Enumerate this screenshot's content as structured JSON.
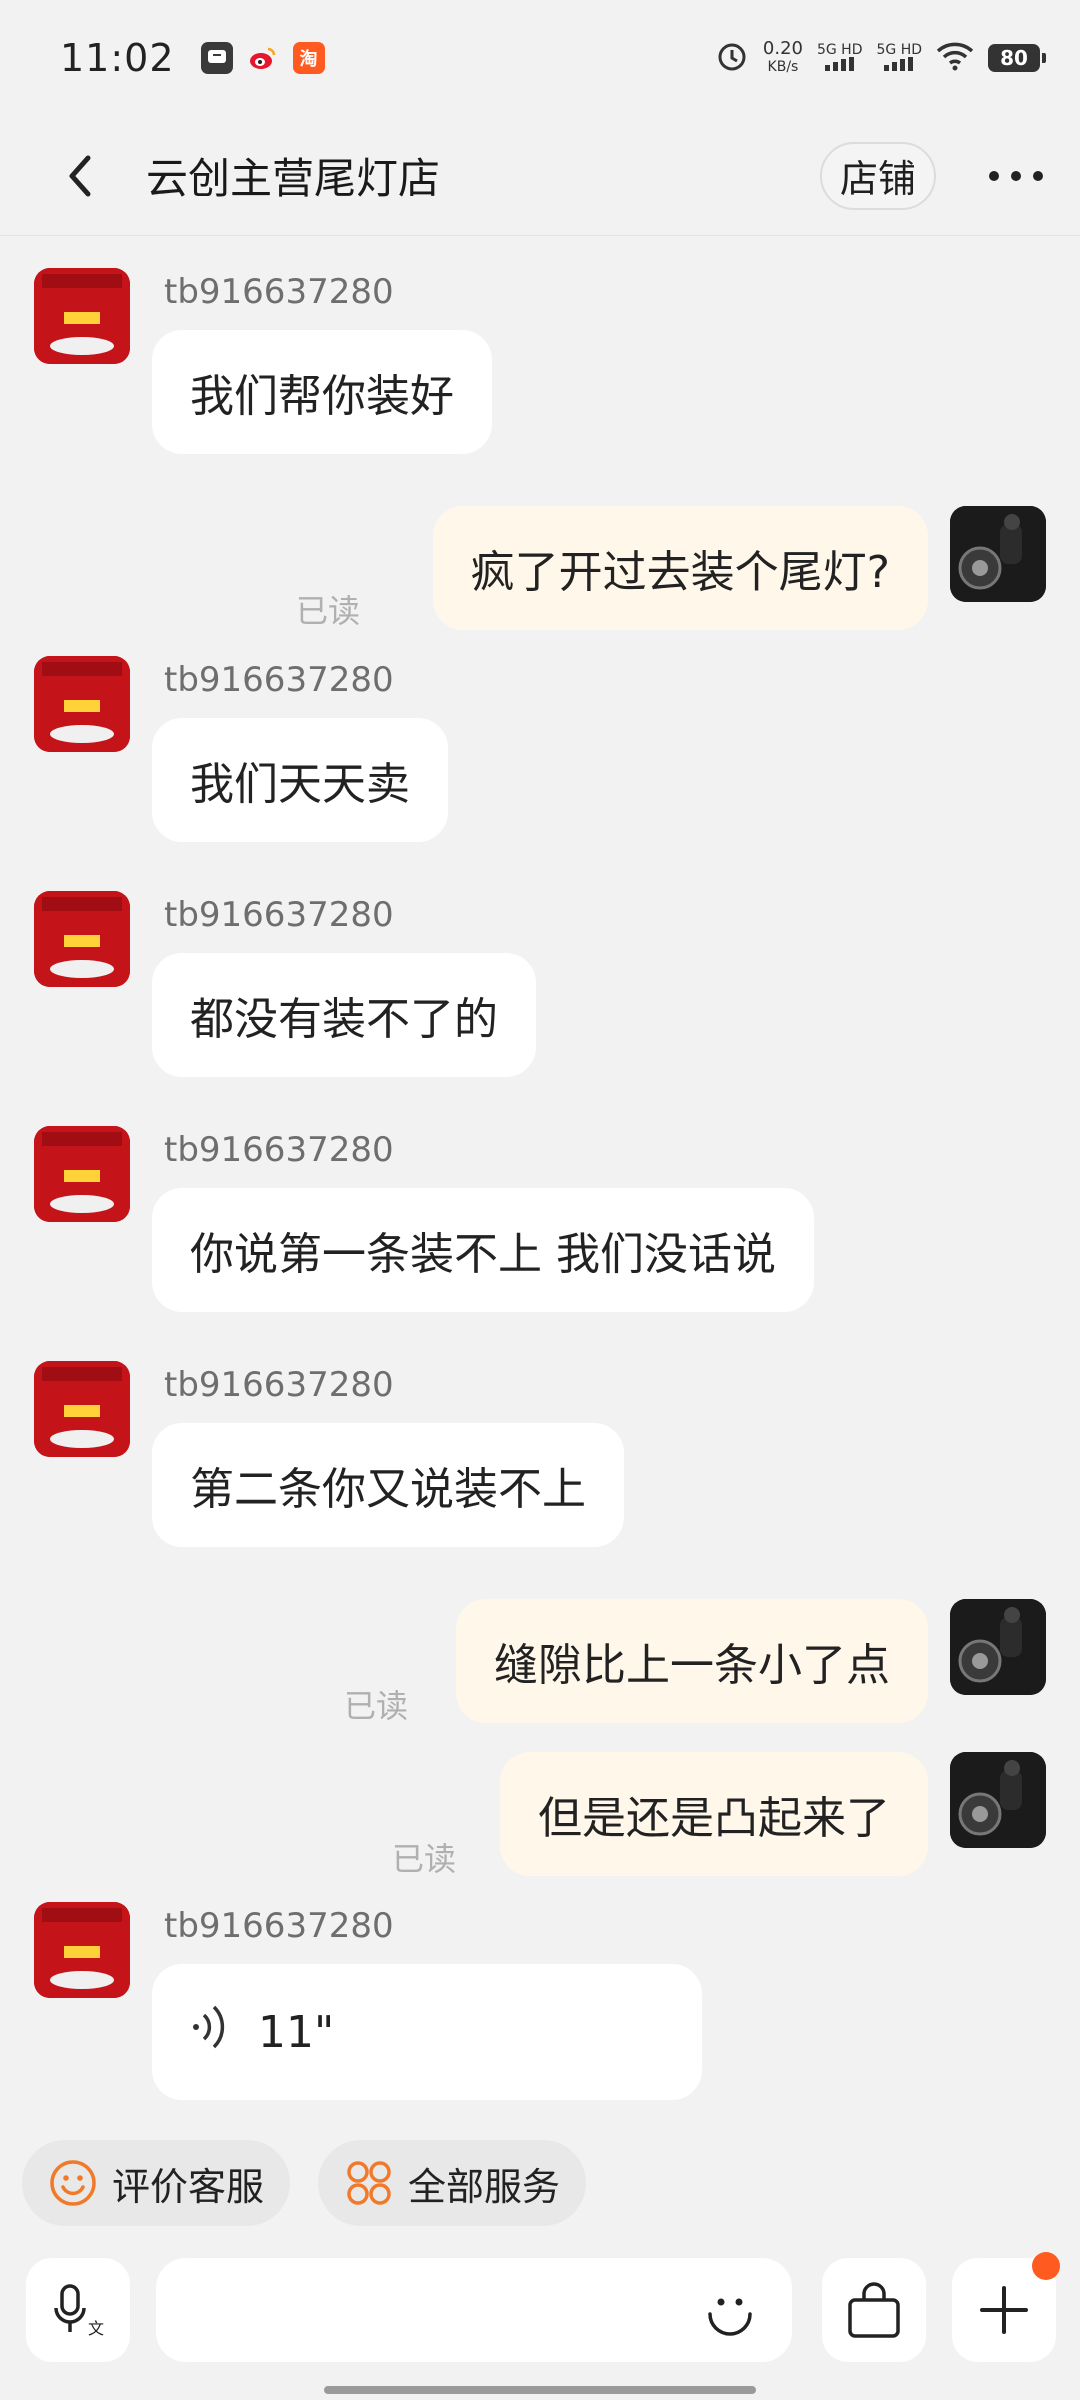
{
  "status_bar": {
    "time": "11:02",
    "net_speed": "0.20",
    "net_unit": "KB/s",
    "sim1": "5G HD",
    "sim2": "5G HD",
    "battery": "80",
    "apps": [
      "message-icon",
      "weibo-icon",
      "taobao-icon"
    ],
    "taobao_label": "淘"
  },
  "header": {
    "title": "云创主营尾灯店",
    "store_button": "店铺"
  },
  "messages": [
    {
      "from": "shop",
      "sender": "tb916637280",
      "text": "我们帮你装好"
    },
    {
      "from": "me",
      "text": "疯了开过去装个尾灯?",
      "status": "已读"
    },
    {
      "from": "shop",
      "sender": "tb916637280",
      "text": "我们天天卖"
    },
    {
      "from": "shop",
      "sender": "tb916637280",
      "text": "都没有装不了的"
    },
    {
      "from": "shop",
      "sender": "tb916637280",
      "text": "你说第一条装不上 我们没话说"
    },
    {
      "from": "shop",
      "sender": "tb916637280",
      "text": "第二条你又说装不上"
    },
    {
      "from": "me",
      "text": "缝隙比上一条小了点",
      "status": "已读"
    },
    {
      "from": "me",
      "text": "但是还是凸起来了",
      "status": "已读"
    },
    {
      "from": "shop",
      "sender": "tb916637280",
      "type": "voice",
      "duration": "11\""
    }
  ],
  "quick_actions": [
    {
      "label": "评价客服",
      "icon": "smile-rating-icon"
    },
    {
      "label": "全部服务",
      "icon": "services-grid-icon"
    }
  ],
  "input_bar": {
    "placeholder": ""
  },
  "colors": {
    "background": "#f2f2f2",
    "incoming_bubble": "#ffffff",
    "outgoing_bubble": "#fff7ea",
    "accent": "#ff5a1f",
    "shop_avatar": "#c4141a"
  }
}
